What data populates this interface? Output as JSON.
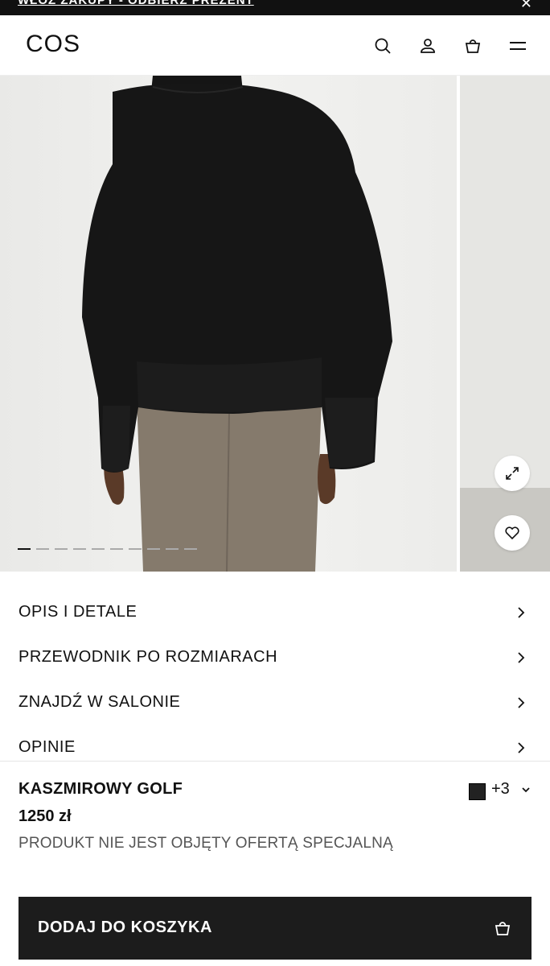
{
  "promo": {
    "text": "WŁÓŻ ZAKUPY - ODBIERZ PREZENT",
    "close_icon": "close-icon"
  },
  "header": {
    "logo": "COS",
    "icons": [
      "search-icon",
      "account-icon",
      "bag-icon",
      "menu-icon"
    ]
  },
  "gallery": {
    "slide_count": 10,
    "active_slide": 1,
    "buttons": [
      "expand-icon",
      "heart-icon"
    ]
  },
  "accordion": [
    {
      "label": "OPIS I DETALE"
    },
    {
      "label": "PRZEWODNIK PO ROZMIARACH"
    },
    {
      "label": "ZNAJDŹ W SALONIE"
    },
    {
      "label": "OPINIE"
    }
  ],
  "product": {
    "name": "KASZMIROWY GOLF",
    "price": "1250 zł",
    "note": "PRODUKT NIE JEST OBJĘTY OFERTĄ SPECJALNĄ",
    "swatch_color": "#222222",
    "more_colors": "+3",
    "add_to_cart": "DODAJ DO KOSZYKA"
  },
  "colors": {
    "black": "#111111",
    "button_bg": "#1c1c1c",
    "sweater": "#161616",
    "skirt": "#857a6c"
  }
}
